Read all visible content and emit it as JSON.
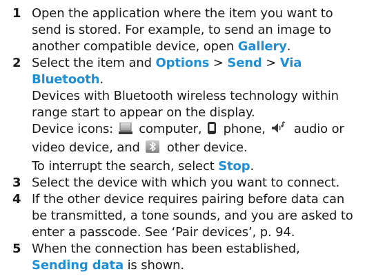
{
  "steps": [
    {
      "number": "1",
      "text_before": "Open the application where the item you want to send is stored. For example, to send an image to another compatible device, open ",
      "link": "Gallery",
      "text_after": "."
    },
    {
      "number": "2",
      "line1_before": "Select the item and ",
      "options": "Options",
      "sep1": " > ",
      "send": "Send",
      "sep2": " > ",
      "via_bluetooth": "Via Bluetooth",
      "line1_after": ".",
      "para2": "Devices with Bluetooth wireless technology within range start to appear on the display.",
      "device_icons_label": "Device icons: ",
      "computer_text": " computer, ",
      "phone_text": " phone, ",
      "audio_text": " audio or video device, and ",
      "other_text": " other device.",
      "interrupt_before": "To interrupt the search, select ",
      "stop": "Stop",
      "interrupt_after": "."
    },
    {
      "number": "3",
      "text": "Select the device with which you want to connect."
    },
    {
      "number": "4",
      "text": "If the other device requires pairing before data can be transmitted, a tone sounds, and you are asked to enter a passcode. See ‘Pair devices’, p. 94."
    },
    {
      "number": "5",
      "text_before": "When the connection has been established, ",
      "link": "Sending data",
      "text_after": " is shown."
    }
  ],
  "colors": {
    "highlight": "#1e8fd6",
    "text": "#1a1a1a"
  },
  "icons": [
    "computer-icon",
    "phone-icon",
    "audio-icon",
    "bluetooth-icon"
  ]
}
